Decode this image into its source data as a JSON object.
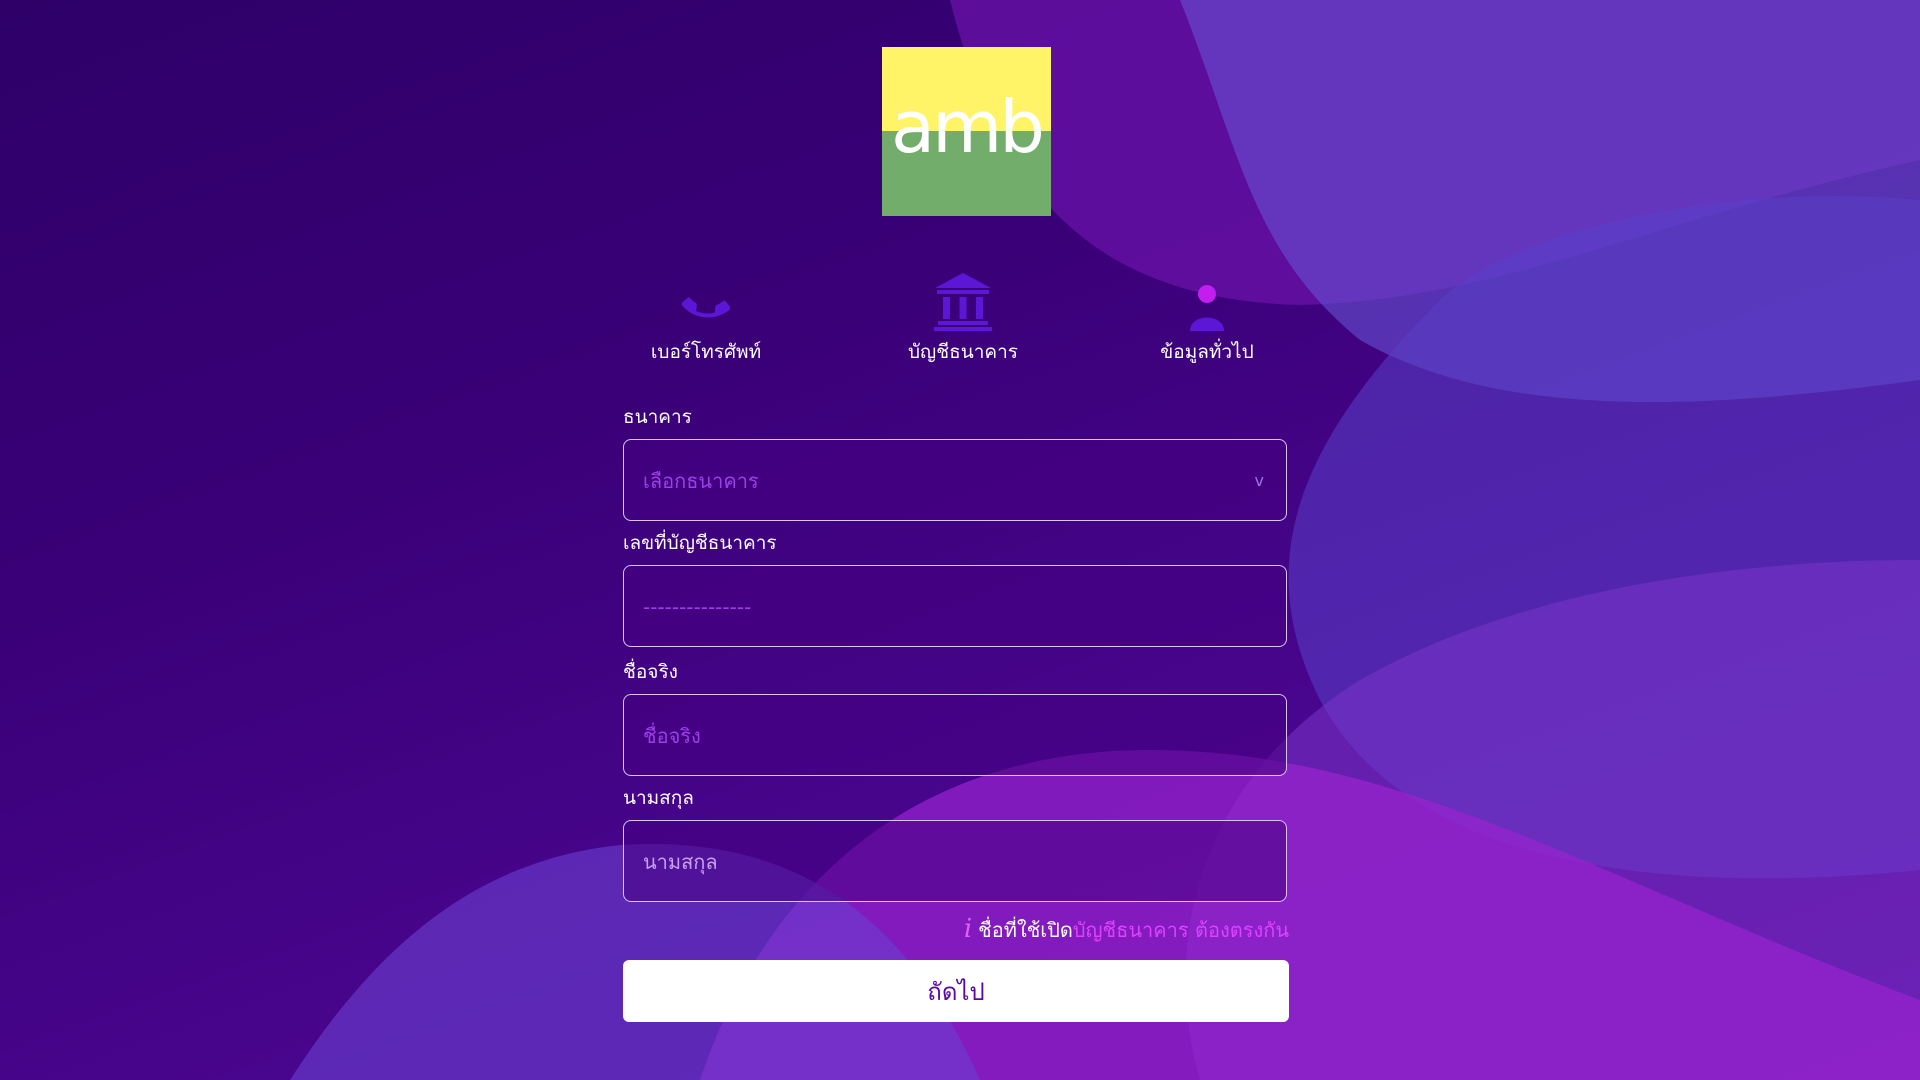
{
  "logo": {
    "text": "amb"
  },
  "steps": [
    {
      "icon": "phone-icon",
      "label": "เบอร์โทรศัพท์"
    },
    {
      "icon": "bank-icon",
      "label": "บัญชีธนาคาร"
    },
    {
      "icon": "user-icon",
      "label": "ข้อมูลทั่วไป"
    }
  ],
  "form": {
    "bank": {
      "label": "ธนาคาร",
      "placeholder": "เลือกธนาคาร",
      "chevron": "v"
    },
    "account": {
      "label": "เลขที่บัญชีธนาคาร",
      "placeholder": "---------------"
    },
    "first_name": {
      "label": "ชื่อจริง",
      "placeholder": "ชื่อจริง"
    },
    "last_name": {
      "label": "นามสกุล",
      "placeholder": "นามสกุล"
    },
    "note": {
      "icon": "i",
      "prefix": "ชื่อที่ใช้เปิด",
      "highlight": "บัญชีธนาคาร",
      "suffix": " ต้องตรงกัน"
    },
    "next_label": "ถัดไป"
  },
  "colors": {
    "background": "#3a0078",
    "accent": "#e040ff",
    "logo_yellow": "#fff467",
    "logo_green": "#73ad6c",
    "button_text": "#5a0aa0"
  }
}
